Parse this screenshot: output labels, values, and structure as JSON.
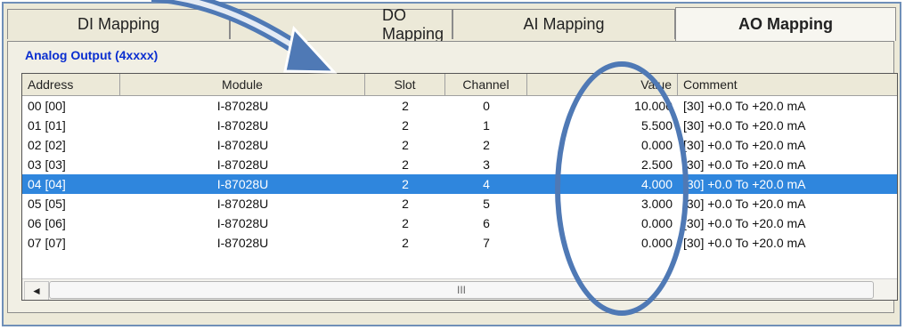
{
  "tabs": [
    "DI Mapping",
    "DO Mapping",
    "AI Mapping",
    "AO Mapping"
  ],
  "active_tab": "AO Mapping",
  "section_title": "Analog Output  (4xxxx)",
  "columns": [
    "Address",
    "Module",
    "Slot",
    "Channel",
    "Value",
    "Comment"
  ],
  "rows": [
    {
      "address": "00 [00]",
      "module": "I-87028U",
      "slot": "2",
      "channel": "0",
      "value": "10.000",
      "comment": "[30] +0.0 To +20.0 mA",
      "selected": false
    },
    {
      "address": "01 [01]",
      "module": "I-87028U",
      "slot": "2",
      "channel": "1",
      "value": "5.500",
      "comment": "[30] +0.0 To +20.0 mA",
      "selected": false
    },
    {
      "address": "02 [02]",
      "module": "I-87028U",
      "slot": "2",
      "channel": "2",
      "value": "0.000",
      "comment": "[30] +0.0 To +20.0 mA",
      "selected": false
    },
    {
      "address": "03 [03]",
      "module": "I-87028U",
      "slot": "2",
      "channel": "3",
      "value": "2.500",
      "comment": "[30] +0.0 To +20.0 mA",
      "selected": false
    },
    {
      "address": "04 [04]",
      "module": "I-87028U",
      "slot": "2",
      "channel": "4",
      "value": "4.000",
      "comment": "[30] +0.0 To +20.0 mA",
      "selected": true
    },
    {
      "address": "05 [05]",
      "module": "I-87028U",
      "slot": "2",
      "channel": "5",
      "value": "3.000",
      "comment": "[30] +0.0 To +20.0 mA",
      "selected": false
    },
    {
      "address": "06 [06]",
      "module": "I-87028U",
      "slot": "2",
      "channel": "6",
      "value": "0.000",
      "comment": "[30] +0.0 To +20.0 mA",
      "selected": false
    },
    {
      "address": "07 [07]",
      "module": "I-87028U",
      "slot": "2",
      "channel": "7",
      "value": "0.000",
      "comment": "[30] +0.0 To +20.0 mA",
      "selected": false
    }
  ],
  "scrollbar": {
    "left_arrow": "◄",
    "thumb_grip": "III"
  },
  "colors": {
    "selection": "#2f86dd",
    "title_blue": "#0a2ed0",
    "annotation": "#4f79b5"
  }
}
